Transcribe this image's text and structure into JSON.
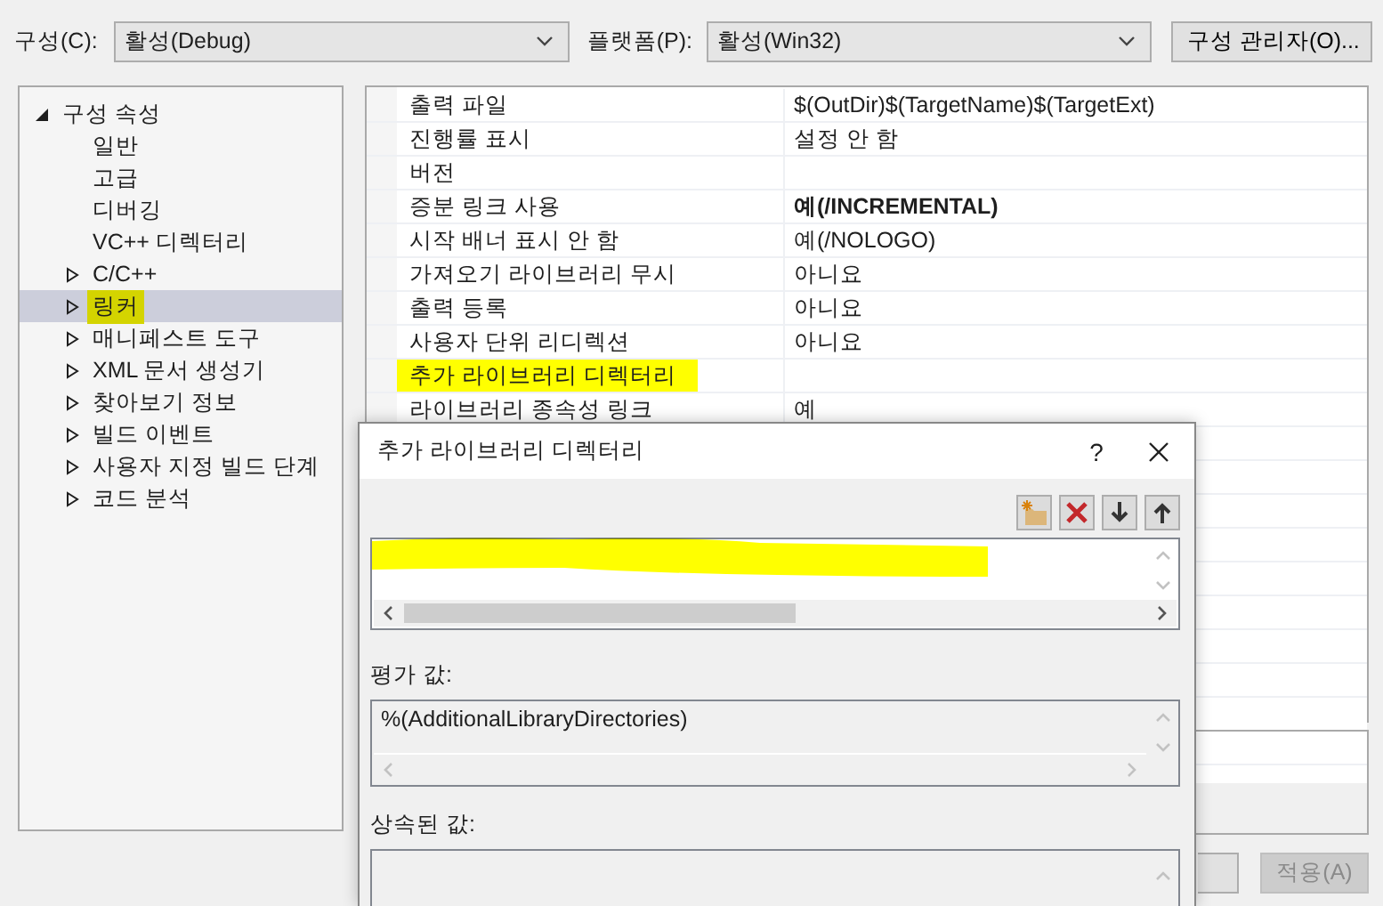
{
  "toolbar": {
    "configuration_label": "구성(C):",
    "configuration_value": "활성(Debug)",
    "platform_label": "플랫폼(P):",
    "platform_value": "활성(Win32)",
    "manager_button": "구성 관리자(O)..."
  },
  "tree": [
    {
      "label": "구성 속성",
      "kind": "group",
      "expanded": true,
      "selected": false,
      "highlighted": false,
      "children": [
        {
          "label": "일반",
          "kind": "page",
          "selected": false,
          "highlighted": false
        },
        {
          "label": "고급",
          "kind": "page",
          "selected": false,
          "highlighted": false
        },
        {
          "label": "디버깅",
          "kind": "page",
          "selected": false,
          "highlighted": false
        },
        {
          "label": "VC++ 디렉터리",
          "kind": "page",
          "selected": false,
          "highlighted": false
        },
        {
          "label": "C/C++",
          "kind": "group",
          "expanded": false,
          "selected": false,
          "highlighted": false
        },
        {
          "label": "링커",
          "kind": "group",
          "expanded": false,
          "selected": true,
          "highlighted": true
        },
        {
          "label": "매니페스트 도구",
          "kind": "group",
          "expanded": false,
          "selected": false,
          "highlighted": false
        },
        {
          "label": "XML 문서 생성기",
          "kind": "group",
          "expanded": false,
          "selected": false,
          "highlighted": false
        },
        {
          "label": "찾아보기 정보",
          "kind": "group",
          "expanded": false,
          "selected": false,
          "highlighted": false
        },
        {
          "label": "빌드 이벤트",
          "kind": "group",
          "expanded": false,
          "selected": false,
          "highlighted": false
        },
        {
          "label": "사용자 지정 빌드 단계",
          "kind": "group",
          "expanded": false,
          "selected": false,
          "highlighted": false
        },
        {
          "label": "코드 분석",
          "kind": "group",
          "expanded": false,
          "selected": false,
          "highlighted": false
        }
      ]
    }
  ],
  "properties": [
    {
      "name": "출력 파일",
      "value": "$(OutDir)$(TargetName)$(TargetExt)",
      "bold": false,
      "highlighted": false
    },
    {
      "name": "진행률 표시",
      "value": "설정 안 함",
      "bold": false,
      "highlighted": false
    },
    {
      "name": "버전",
      "highlighted": false
    },
    {
      "name": "증분 링크 사용",
      "value": "예(/INCREMENTAL)",
      "bold": true,
      "highlighted": false
    },
    {
      "name": "시작 배너 표시 안 함",
      "value": "예(/NOLOGO)",
      "bold": false,
      "highlighted": false
    },
    {
      "name": "가져오기 라이브러리 무시",
      "value": "아니요",
      "bold": false,
      "highlighted": false
    },
    {
      "name": "출력 등록",
      "value": "아니요",
      "bold": false,
      "highlighted": false
    },
    {
      "name": "사용자 단위 리디렉션",
      "value": "아니요",
      "bold": false,
      "highlighted": false
    },
    {
      "name": "추가 라이브러리 디렉터리",
      "highlighted": true
    },
    {
      "name": "라이브러리 종속성 링크",
      "value": "예",
      "bold": false,
      "highlighted": false
    }
  ],
  "buttons": [
    {
      "label": "적용(A)",
      "disabled": true
    }
  ],
  "dialog": {
    "title": "추가 라이브러리 디렉터리",
    "help": "?",
    "evaluated_label": "평가 값:",
    "evaluated_value": "%(AdditionalLibraryDirectories)",
    "inherited_label": "상속된 값:"
  }
}
